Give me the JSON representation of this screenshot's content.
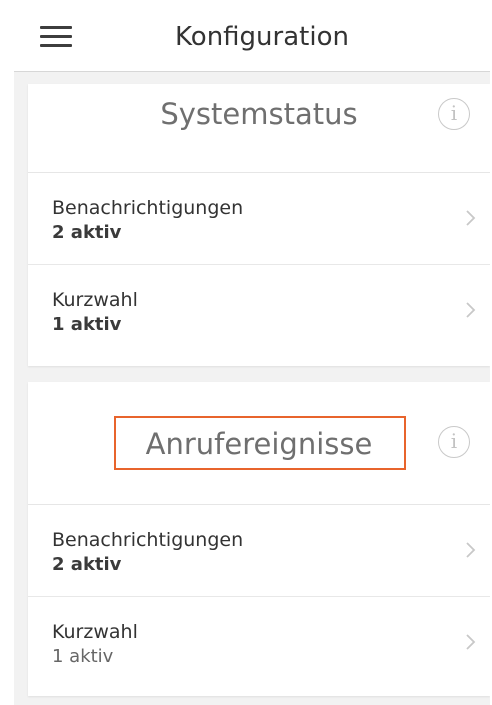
{
  "header": {
    "title": "Konfiguration",
    "menu_icon": "hamburger-menu-icon"
  },
  "sections": [
    {
      "title": "Systemstatus",
      "info_icon": "info-icon",
      "info_glyph": "i",
      "items": [
        {
          "title": "Benachrichtigungen",
          "value": "2 aktiv"
        },
        {
          "title": "Kurzwahl",
          "value": "1 aktiv"
        }
      ]
    },
    {
      "title": "Anrufereignisse",
      "info_icon": "info-icon",
      "info_glyph": "i",
      "highlight_color": "#e8642c",
      "items": [
        {
          "title": "Benachrichtigungen",
          "value": "2 aktiv"
        },
        {
          "title": "Kurzwahl",
          "value": "1 aktiv"
        }
      ]
    }
  ],
  "colors": {
    "background": "#f2f2f2",
    "card": "#ffffff",
    "highlight": "#e8642c",
    "chevron": "#c8c8c8"
  }
}
